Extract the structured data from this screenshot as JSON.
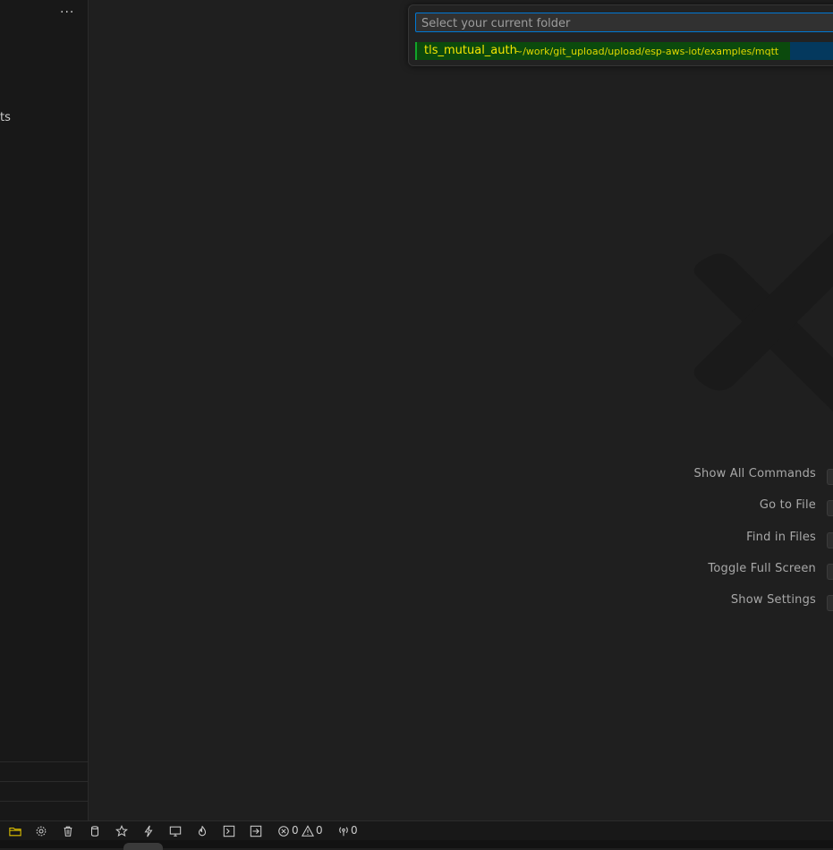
{
  "sidebar": {
    "more_label": "···",
    "partial_text": "ts"
  },
  "quick_pick": {
    "placeholder": "Select your current folder",
    "items": [
      {
        "label": "tls_mutual_auth",
        "description": "~/work/git_upload/upload/esp-aws-iot/examples/mqtt"
      }
    ]
  },
  "editor": {
    "shortcuts": [
      "Show All Commands",
      "Go to File",
      "Find in Files",
      "Toggle Full Screen",
      "Show Settings"
    ]
  },
  "statusbar": {
    "errors": "0",
    "warnings": "0",
    "ports": "0"
  },
  "colors": {
    "accent": "#0078d4",
    "selection_bg": "#04395e",
    "highlight_green": "#0b4a0d",
    "highlight_text": "#f5e600"
  }
}
